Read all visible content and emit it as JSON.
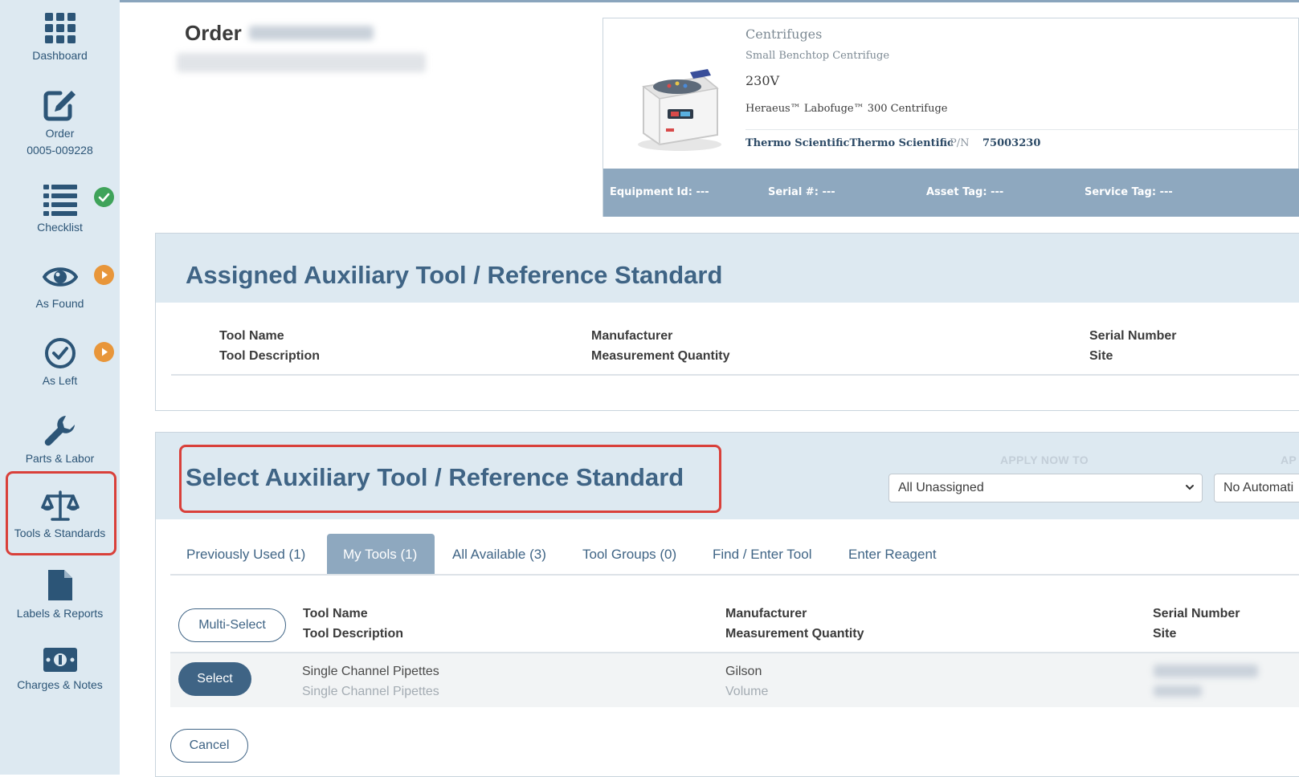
{
  "sidebar": {
    "items": [
      {
        "label": "Dashboard",
        "icon": "grid-icon"
      },
      {
        "label": "Order\n0005-009228",
        "icon": "edit-icon"
      },
      {
        "label": "Checklist",
        "icon": "list-icon",
        "status": "complete"
      },
      {
        "label": "As Found",
        "icon": "eye-icon",
        "status": "pending"
      },
      {
        "label": "As Left",
        "icon": "check-circle-icon",
        "status": "pending"
      },
      {
        "label": "Parts & Labor",
        "icon": "wrench-icon"
      },
      {
        "label": "Tools & Standards",
        "icon": "scale-icon",
        "selected": true
      },
      {
        "label": "Labels & Reports",
        "icon": "document-icon"
      },
      {
        "label": "Charges & Notes",
        "icon": "money-icon"
      }
    ]
  },
  "header": {
    "order_label": "Order"
  },
  "equipment": {
    "category": "Centrifuges",
    "subcategory": "Small Benchtop Centrifuge",
    "voltage": "230V",
    "model": "Heraeus™ Labofuge™ 300 Centrifuge",
    "manufacturer": "Thermo ScientificThermo Scientific",
    "pn_label": "P/N",
    "pn": "75003230",
    "fields": [
      {
        "label": "Equipment Id:",
        "value": "---"
      },
      {
        "label": "Serial #:",
        "value": "---"
      },
      {
        "label": "Asset Tag:",
        "value": "---"
      },
      {
        "label": "Service Tag:",
        "value": "---"
      }
    ]
  },
  "assigned": {
    "title": "Assigned Auxiliary Tool / Reference Standard",
    "columns": {
      "c1a": "Tool Name",
      "c1b": "Tool Description",
      "c2a": "Manufacturer",
      "c2b": "Measurement Quantity",
      "c3a": "Serial Number",
      "c3b": "Site"
    }
  },
  "select_panel": {
    "title": "Select Auxiliary Tool / Reference Standard",
    "apply_label": "APPLY NOW TO",
    "apply_label2": "AP",
    "apply_value": "All Unassigned",
    "second_select_value": "No Automati",
    "tabs": [
      {
        "label": "Previously Used (1)",
        "active": false
      },
      {
        "label": "My Tools (1)",
        "active": true
      },
      {
        "label": "All Available (3)",
        "active": false
      },
      {
        "label": "Tool Groups (0)",
        "active": false
      },
      {
        "label": "Find / Enter Tool",
        "active": false
      },
      {
        "label": "Enter Reagent",
        "active": false
      }
    ],
    "multi_select_label": "Multi-Select",
    "columns": {
      "c1a": "Tool Name",
      "c1b": "Tool Description",
      "c2a": "Manufacturer",
      "c2b": "Measurement Quantity",
      "c3a": "Serial Number",
      "c3b": "Site"
    },
    "rows": [
      {
        "select_label": "Select",
        "tool_name": "Single Channel Pipettes",
        "tool_description": "Single Channel Pipettes",
        "manufacturer": "Gilson",
        "measurement_quantity": "Volume"
      }
    ],
    "cancel_label": "Cancel"
  },
  "colors": {
    "sidebar_bg": "#dde9f1",
    "accent": "#3f6485",
    "highlight": "#d9403a",
    "status_ok": "#3fa35a",
    "status_pending": "#e8963a"
  }
}
